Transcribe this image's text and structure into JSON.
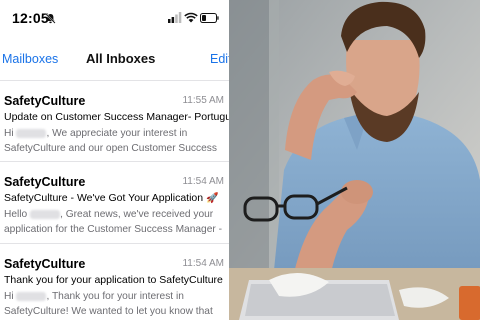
{
  "status_bar": {
    "time": "12:05"
  },
  "nav": {
    "back_label": "Mailboxes",
    "title": "All Inboxes",
    "edit_label": "Edit"
  },
  "emails": [
    {
      "sender": "SafetyCulture",
      "time": "11:55 AM",
      "subject": "Update on Customer Success Manager- Portuguese",
      "preview_start": "Hi",
      "preview_rest": ", We appreciate your interest in SafetyCulture and our open Customer Success Manager"
    },
    {
      "sender": "SafetyCulture",
      "time": "11:54 AM",
      "subject": "SafetyCulture - We've Got Your Application",
      "subject_emoji": "🚀",
      "preview_start": "Hello",
      "preview_rest": ", Great news, we've received your application for the Customer Success Manager - Portuguese"
    },
    {
      "sender": "SafetyCulture",
      "time": "11:54 AM",
      "subject": "Thank you for your application to SafetyCulture",
      "preview_start": "Hi",
      "preview_rest": ", Thank you for your interest in SafetyCulture! We wanted to let you know that we"
    }
  ],
  "colors": {
    "link": "#1a73e8",
    "secondary_text": "#8e8e93",
    "divider": "#e3e3e6"
  },
  "icons": [
    "bell-slash-icon",
    "signal-icon",
    "wifi-icon",
    "battery-icon"
  ]
}
